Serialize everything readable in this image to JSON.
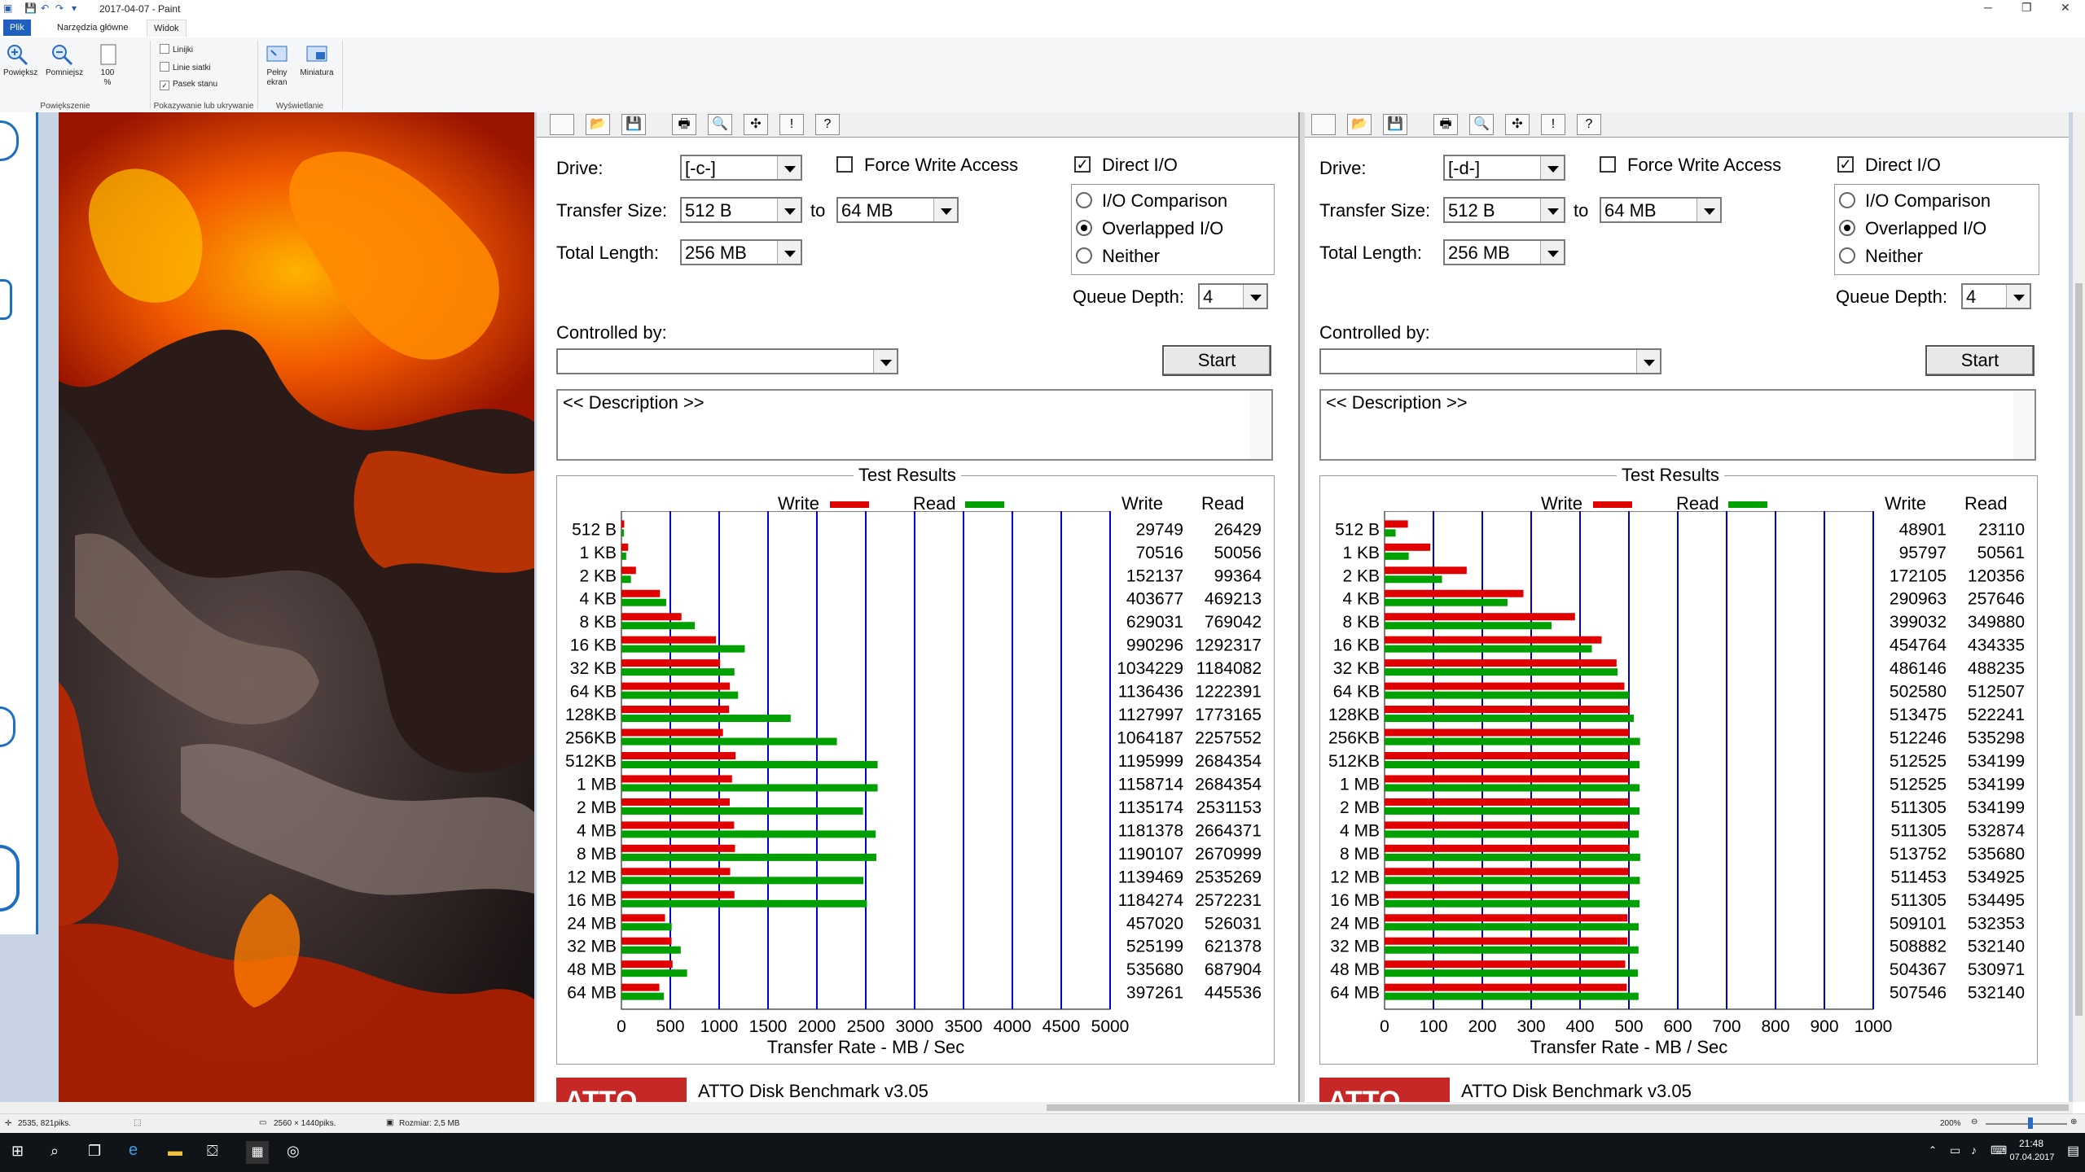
{
  "app": {
    "title": "2017-04-07 - Paint",
    "tabs": [
      "Plik",
      "Narzędzia główne",
      "Widok"
    ],
    "ribbon": {
      "zoom_in": "Powiększ",
      "zoom_out": "Pomniejsz",
      "zoom_100": "100 %",
      "group_zoom": "Powiększenie",
      "rulers": "Linijki",
      "gridlines": "Linie siatki",
      "statusbar": "Pasek stanu",
      "rulers_checked": false,
      "gridlines_checked": false,
      "statusbar_checked": true,
      "group_show": "Pokazywanie lub ukrywanie",
      "fullscreen": "Pełny ekran",
      "thumbnail": "Miniatura",
      "group_display": "Wyświetlanie"
    },
    "status": {
      "cursor": "2535, 821piks.",
      "dimensions": "2560 × 1440piks.",
      "size": "Rozmiar: 2,5 MB",
      "zoom": "200%"
    },
    "taskbar": {
      "time": "21:48",
      "date": "07.04.2017"
    }
  },
  "atto_left": {
    "drive_label": "Drive:",
    "drive": "[-c-]",
    "force_write_label": "Force Write Access",
    "force_write": false,
    "direct_io_label": "Direct I/O",
    "direct_io": true,
    "transfer_label": "Transfer Size:",
    "transfer_from": "512 B",
    "to_label": "to",
    "transfer_to": "64 MB",
    "total_label": "Total Length:",
    "total_length": "256 MB",
    "io_comparison": "I/O Comparison",
    "overlapped_io": "Overlapped I/O",
    "neither": "Neither",
    "selected_mode": "Overlapped I/O",
    "queue_label": "Queue Depth:",
    "queue_depth": "4",
    "controlled_label": "Controlled by:",
    "controlled_by": "",
    "start": "Start",
    "description": "<< Description >>",
    "results_title": "Test Results",
    "write_legend": "Write",
    "read_legend": "Read",
    "col_write": "Write",
    "col_read": "Read",
    "footer": "ATTO Disk Benchmark v3.05",
    "logo": "ATTO"
  },
  "atto_right": {
    "drive_label": "Drive:",
    "drive": "[-d-]",
    "force_write_label": "Force Write Access",
    "force_write": false,
    "direct_io_label": "Direct I/O",
    "direct_io": true,
    "transfer_label": "Transfer Size:",
    "transfer_from": "512 B",
    "to_label": "to",
    "transfer_to": "64 MB",
    "total_label": "Total Length:",
    "total_length": "256 MB",
    "io_comparison": "I/O Comparison",
    "overlapped_io": "Overlapped I/O",
    "neither": "Neither",
    "selected_mode": "Overlapped I/O",
    "queue_label": "Queue Depth:",
    "queue_depth": "4",
    "controlled_label": "Controlled by:",
    "controlled_by": "",
    "start": "Start",
    "description": "<< Description >>",
    "results_title": "Test Results",
    "write_legend": "Write",
    "read_legend": "Read",
    "col_write": "Write",
    "col_read": "Read",
    "footer": "ATTO Disk Benchmark v3.05",
    "logo": "ATTO"
  },
  "colors": {
    "write": "#e00000",
    "read": "#00a000",
    "grid": "#0000cc",
    "ribbon_tab": "#1e5fbf"
  },
  "chart_data": [
    {
      "type": "bar",
      "title": "Test Results",
      "xlabel": "Transfer Rate - MB / Sec",
      "xlim": [
        0,
        5000
      ],
      "xticks": [
        "0",
        "500",
        "1000",
        "1500",
        "2000",
        "2500",
        "3000",
        "3500",
        "4000",
        "4500",
        "5000"
      ],
      "categories": [
        "512 B",
        "1 KB",
        "2 KB",
        "4 KB",
        "8 KB",
        "16 KB",
        "32 KB",
        "64 KB",
        "128KB",
        "256KB",
        "512KB",
        "1 MB",
        "2 MB",
        "4 MB",
        "8 MB",
        "12 MB",
        "16 MB",
        "24 MB",
        "32 MB",
        "48 MB",
        "64 MB"
      ],
      "series": [
        {
          "name": "Write",
          "values": [
            29749,
            70516,
            152137,
            403677,
            629031,
            990296,
            1034229,
            1136436,
            1127997,
            1064187,
            1195999,
            1158714,
            1135174,
            1181378,
            1190107,
            1139469,
            1184274,
            457020,
            525199,
            535680,
            397261
          ]
        },
        {
          "name": "Read",
          "values": [
            26429,
            50056,
            99364,
            469213,
            769042,
            1292317,
            1184082,
            1222391,
            1773165,
            2257552,
            2684354,
            2684354,
            2531153,
            2664371,
            2670999,
            2535269,
            2572231,
            526031,
            621378,
            687904,
            445536
          ]
        }
      ]
    },
    {
      "type": "bar",
      "title": "Test Results",
      "xlabel": "Transfer Rate - MB / Sec",
      "xlim": [
        0,
        1000
      ],
      "xticks": [
        "0",
        "100",
        "200",
        "300",
        "400",
        "500",
        "600",
        "700",
        "800",
        "900",
        "1000"
      ],
      "categories": [
        "512 B",
        "1 KB",
        "2 KB",
        "4 KB",
        "8 KB",
        "16 KB",
        "32 KB",
        "64 KB",
        "128KB",
        "256KB",
        "512KB",
        "1 MB",
        "2 MB",
        "4 MB",
        "8 MB",
        "12 MB",
        "16 MB",
        "24 MB",
        "32 MB",
        "48 MB",
        "64 MB"
      ],
      "series": [
        {
          "name": "Write",
          "values": [
            48901,
            95797,
            172105,
            290963,
            399032,
            454764,
            486146,
            502580,
            513475,
            512246,
            512525,
            512525,
            511305,
            511305,
            513752,
            511453,
            511305,
            509101,
            508882,
            504367,
            507546
          ]
        },
        {
          "name": "Read",
          "values": [
            23110,
            50561,
            120356,
            257646,
            349880,
            434335,
            488235,
            512507,
            522241,
            535298,
            534199,
            534199,
            534199,
            532874,
            535680,
            534925,
            534495,
            532353,
            532140,
            530971,
            532140
          ]
        }
      ]
    }
  ]
}
